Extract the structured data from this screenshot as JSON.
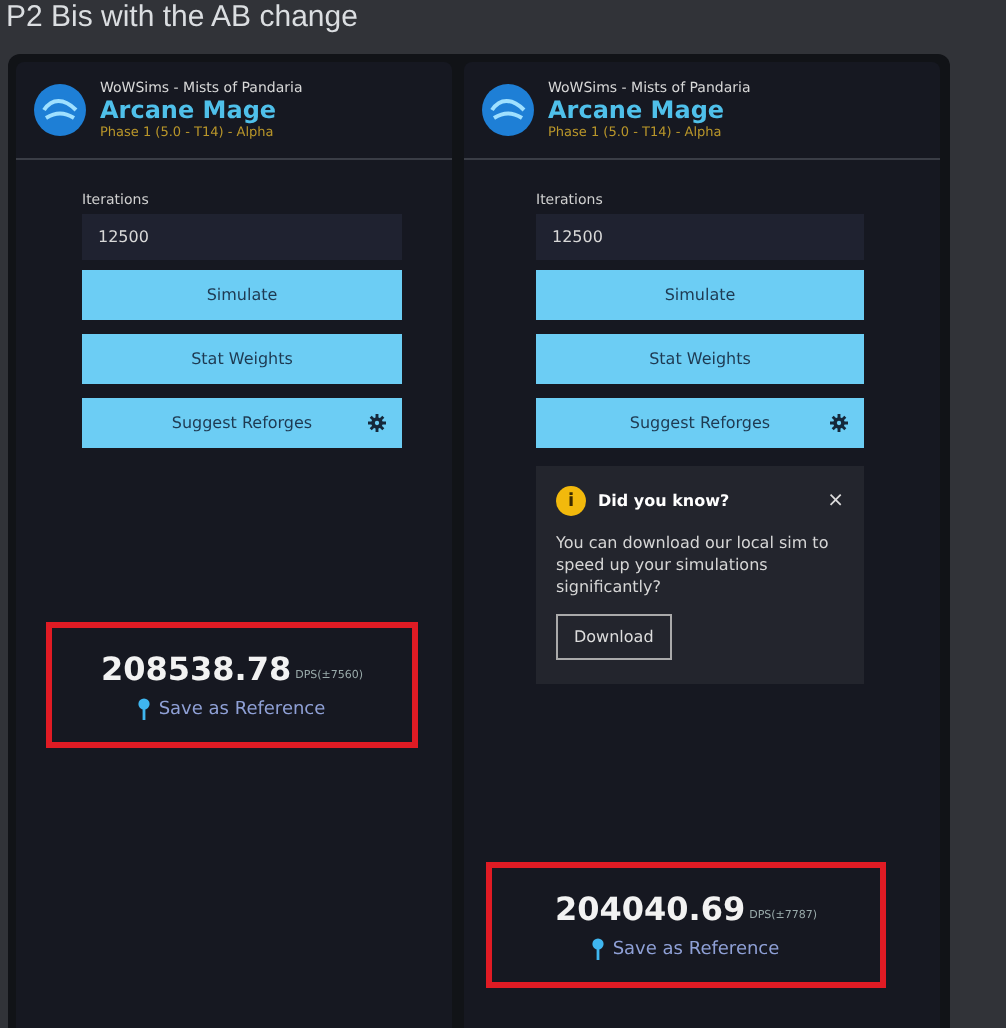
{
  "message": {
    "text": "P2 Bis with the AB change"
  },
  "panels": [
    {
      "header": {
        "subtitle": "WoWSims - Mists of Pandaria",
        "title": "Arcane Mage",
        "phase": "Phase 1 (5.0 - T14) - Alpha"
      },
      "iterations": {
        "label": "Iterations",
        "value": "12500"
      },
      "buttons": [
        {
          "label": "Simulate",
          "kind": "plain"
        },
        {
          "label": "Stat Weights",
          "kind": "plain"
        },
        {
          "label": "Suggest Reforges",
          "kind": "settings"
        }
      ],
      "result": {
        "dps": "208538.78",
        "detail": "DPS(±7560)",
        "save": "Save as Reference",
        "highlighted": true
      }
    },
    {
      "header": {
        "subtitle": "WoWSims - Mists of Pandaria",
        "title": "Arcane Mage",
        "phase": "Phase 1 (5.0 - T14) - Alpha"
      },
      "iterations": {
        "label": "Iterations",
        "value": "12500"
      },
      "buttons": [
        {
          "label": "Simulate",
          "kind": "plain"
        },
        {
          "label": "Stat Weights",
          "kind": "plain"
        },
        {
          "label": "Suggest Reforges",
          "kind": "settings"
        }
      ],
      "tip": {
        "icon": "i",
        "title": "Did you know?",
        "close": "×",
        "text": "You can download our local sim to speed up your simulations significantly?",
        "action": "Download"
      },
      "result": {
        "dps": "204040.69",
        "detail": "DPS(±7787)",
        "save": "Save as Reference",
        "highlighted": true
      }
    }
  ]
}
